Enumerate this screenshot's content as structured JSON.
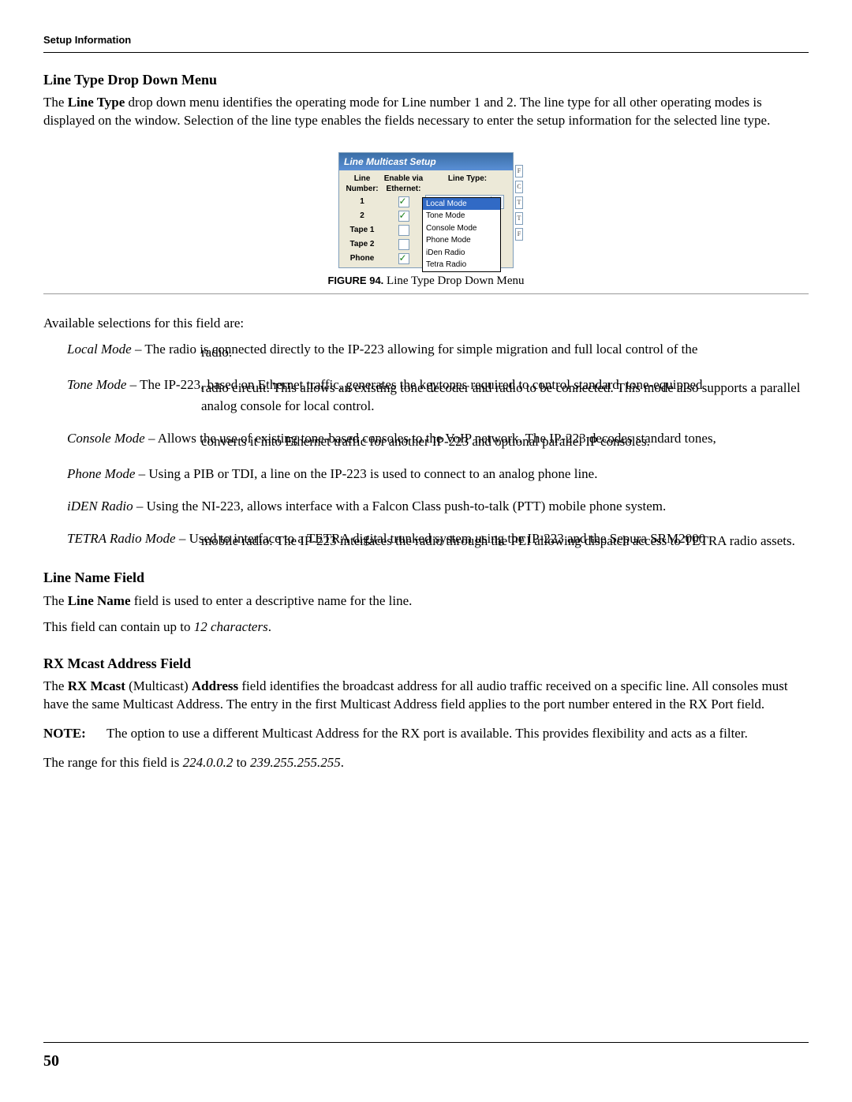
{
  "header": {
    "label": "Setup Information"
  },
  "section1": {
    "title": "Line Type Drop Down Menu",
    "intro_pre": "The ",
    "intro_bold": "Line Type",
    "intro_post": " drop down menu identifies the operating mode for Line number 1 and 2. The line type for all other operating modes is displayed on the window. Selection of the line type enables the fields necessary to enter the setup information for the selected line type."
  },
  "figure": {
    "window_title": "Line Multicast Setup",
    "headers": {
      "ln": "Line Number:",
      "en": "Enable via Ethernet:",
      "lt": "Line Type:"
    },
    "rows": [
      {
        "label": "1",
        "checked": true
      },
      {
        "label": "2",
        "checked": true
      },
      {
        "label": "Tape 1",
        "checked": false
      },
      {
        "label": "Tape 2",
        "checked": false
      },
      {
        "label": "Phone",
        "checked": true
      }
    ],
    "select_value": "Local Mode",
    "dropdown": [
      "Local Mode",
      "Tone Mode",
      "Console Mode",
      "Phone Mode",
      "iDen Radio",
      "Tetra Radio"
    ],
    "side_letters": [
      "F",
      "C",
      "T",
      "T",
      "F"
    ],
    "caption_label": "FIGURE 94.",
    "caption_text": "  Line Type Drop Down Menu"
  },
  "avail_intro": "Available selections for this field are:",
  "modes": [
    {
      "term": "Local Mode",
      "dash": " – ",
      "first": "The radio is connected directly to the IP-223 allowing for simple migration and full local control of the",
      "cont": [
        "radio."
      ]
    },
    {
      "term": "Tone Mode",
      "dash": " – ",
      "first": "The IP-223, based on Ethernet traffic, generates the keytones required to control standard, tone-equipped",
      "cont": [
        "radio circuit. This allows an existing tone decoder and radio to be connected. This mode also supports a parallel analog console for local control."
      ]
    },
    {
      "term": "Console Mode",
      "dash": " – ",
      "first": "Allows the use of existing tone-based consoles to the VoIP network. The IP-223 decodes standard tones,",
      "cont": [
        "converts it into Ethernet traffic for another IP-223 and optional parallel IP consoles."
      ]
    },
    {
      "term": "Phone Mode",
      "dash": " – ",
      "first": "Using a PIB or TDI, a line on the IP-223 is used to connect to an analog phone line.",
      "cont": []
    },
    {
      "term": "iDEN Radio",
      "dash": " – ",
      "first": "Using the NI-223, allows interface with a Falcon Class push-to-talk (PTT) mobile phone system.",
      "cont": []
    },
    {
      "term": "TETRA Radio Mode",
      "dash": " – ",
      "first": "Used to interface to a TETRA digital trunked system using the IP-223 and the Sepura SRM2000",
      "cont": [
        "mobile radio. The IP-223 interfaces the radio through the PEI allowing dispatch access to TETRA radio assets."
      ]
    }
  ],
  "section2": {
    "title": "Line Name Field",
    "p1_pre": "The ",
    "p1_bold": "Line Name",
    "p1_post": " field is used to enter a descriptive name for the line.",
    "p2_pre": "This field can contain up to ",
    "p2_ital": "12 characters",
    "p2_post": "."
  },
  "section3": {
    "title": "RX Mcast Address Field",
    "p1_a": "The ",
    "p1_b1": "RX Mcast",
    "p1_c": " (Multicast) ",
    "p1_b2": "Address",
    "p1_d": " field identifies the broadcast address for all audio traffic received on a specific line. All consoles must have the same Multicast Address. The entry in the first Multicast Address field applies to the port number entered in the RX Port field.",
    "note_label": "NOTE:",
    "note_text": "The option to use a different Multicast Address for the RX port is available. This provides flexibility and acts as a filter.",
    "range_pre": "The range for this field is ",
    "range_a": "224.0.0.2",
    "range_mid": " to ",
    "range_b": "239.255.255.255",
    "range_post": "."
  },
  "footer": {
    "page_number": "50"
  }
}
